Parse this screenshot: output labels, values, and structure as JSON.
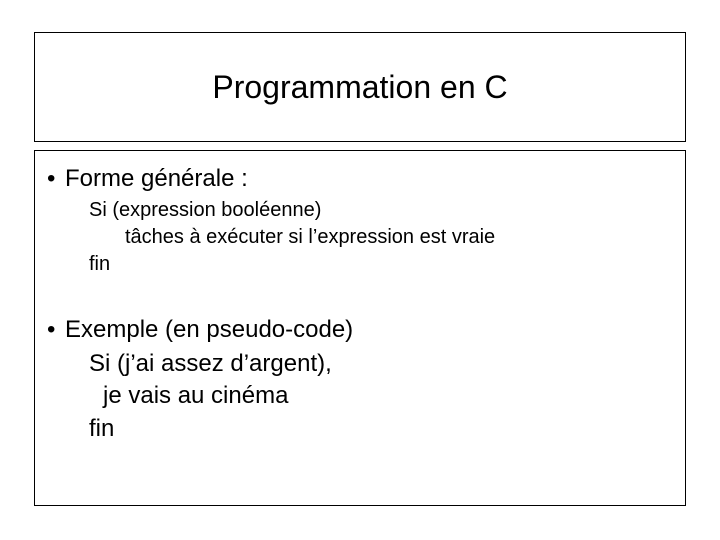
{
  "title": "Programmation en C",
  "section1": {
    "heading": "Forme générale :",
    "line1": "Si (expression booléenne)",
    "line2": "tâches à exécuter si l’expression est vraie",
    "line3": "fin"
  },
  "section2": {
    "heading": "Exemple (en pseudo-code)",
    "line1": "Si (j’ai assez d’argent),",
    "line2": "je vais au cinéma",
    "line3": "fin"
  }
}
